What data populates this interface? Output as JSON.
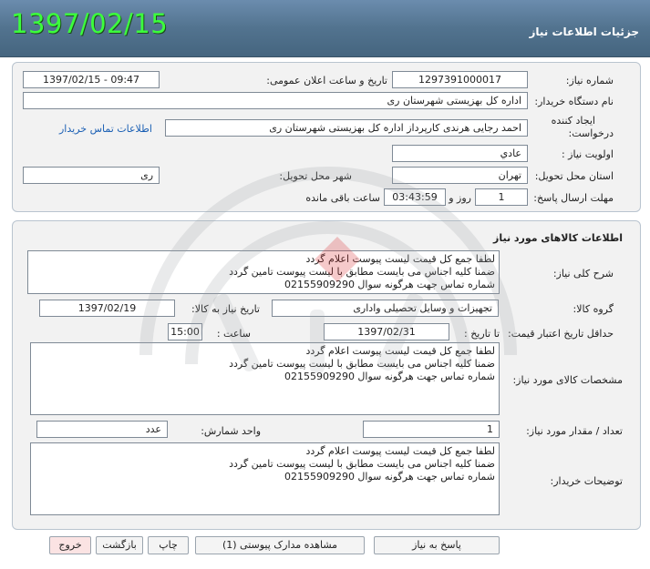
{
  "header": {
    "date": "1397/02/15",
    "title": "جزئیات اطلاعات نیاز"
  },
  "info": {
    "need_number_label": "شماره نیاز:",
    "need_number": "1297391000017",
    "announce_label": "تاریخ و ساعت اعلان عمومی:",
    "announce_value": "1397/02/15 - 09:47",
    "buyer_org_label": "نام دستگاه خریدار:",
    "buyer_org": "اداره کل بهزیستی شهرستان ری",
    "requester_label_1": "ایجاد کننده",
    "requester_label_2": "درخواست:",
    "requester": "احمد رجایی هرندی کارپرداز اداره کل بهزیستی شهرستان ری",
    "contact_link": "اطلاعات تماس خریدار",
    "priority_label": "اولویت نیاز :",
    "priority": "عادي",
    "province_label": "استان محل تحویل:",
    "province": "تهران",
    "city_label": "شهر محل تحویل:",
    "city": "ری",
    "deadline_label": "مهلت ارسال پاسخ:",
    "deadline_days": "1",
    "days_word": "روز و",
    "deadline_time": "03:43:59",
    "remaining_word": "ساعت باقی مانده"
  },
  "goods": {
    "section_title": "اطلاعات کالاهای مورد نیاز",
    "general_desc_label": "شرح کلی نیاز:",
    "description_lines": [
      "لطفا جمع کل قیمت لیست پیوست اعلام گردد",
      "ضمنا کلیه اجناس می بایست مطابق با لیست پیوست تامین گردد",
      "شماره تماس جهت هرگونه سوال 02155909290"
    ],
    "group_label": "گروه کالا:",
    "group_value": "تجهیزات و وسایل تحصیلی واداری",
    "need_date_label": "تاریخ نیاز به کالا:",
    "need_date": "1397/02/19",
    "min_price_label": "حداقل تاریخ اعتبار قیمت:",
    "until_date_label": "تا تاریخ :",
    "until_date": "1397/02/31",
    "time_label": "ساعت :",
    "time_value": "15:00",
    "specs_label": "مشخصات کالای مورد نیاز:",
    "qty_label": "تعداد / مقدار مورد نیاز:",
    "qty_value": "1",
    "unit_label": "واحد شمارش:",
    "unit_value": "عدد",
    "buyer_notes_label": "توضیحات خریدار:"
  },
  "buttons": {
    "reply": "پاسخ به نیاز",
    "attachments": "مشاهده مدارک پیوستی (1)",
    "print": "چاپ",
    "back": "بازگشت",
    "exit": "خروج"
  },
  "colors": {
    "header": "#52738f",
    "date_green": "#3cff3c",
    "link": "#1a5fb4",
    "exit_bg": "#fbe3e3"
  }
}
